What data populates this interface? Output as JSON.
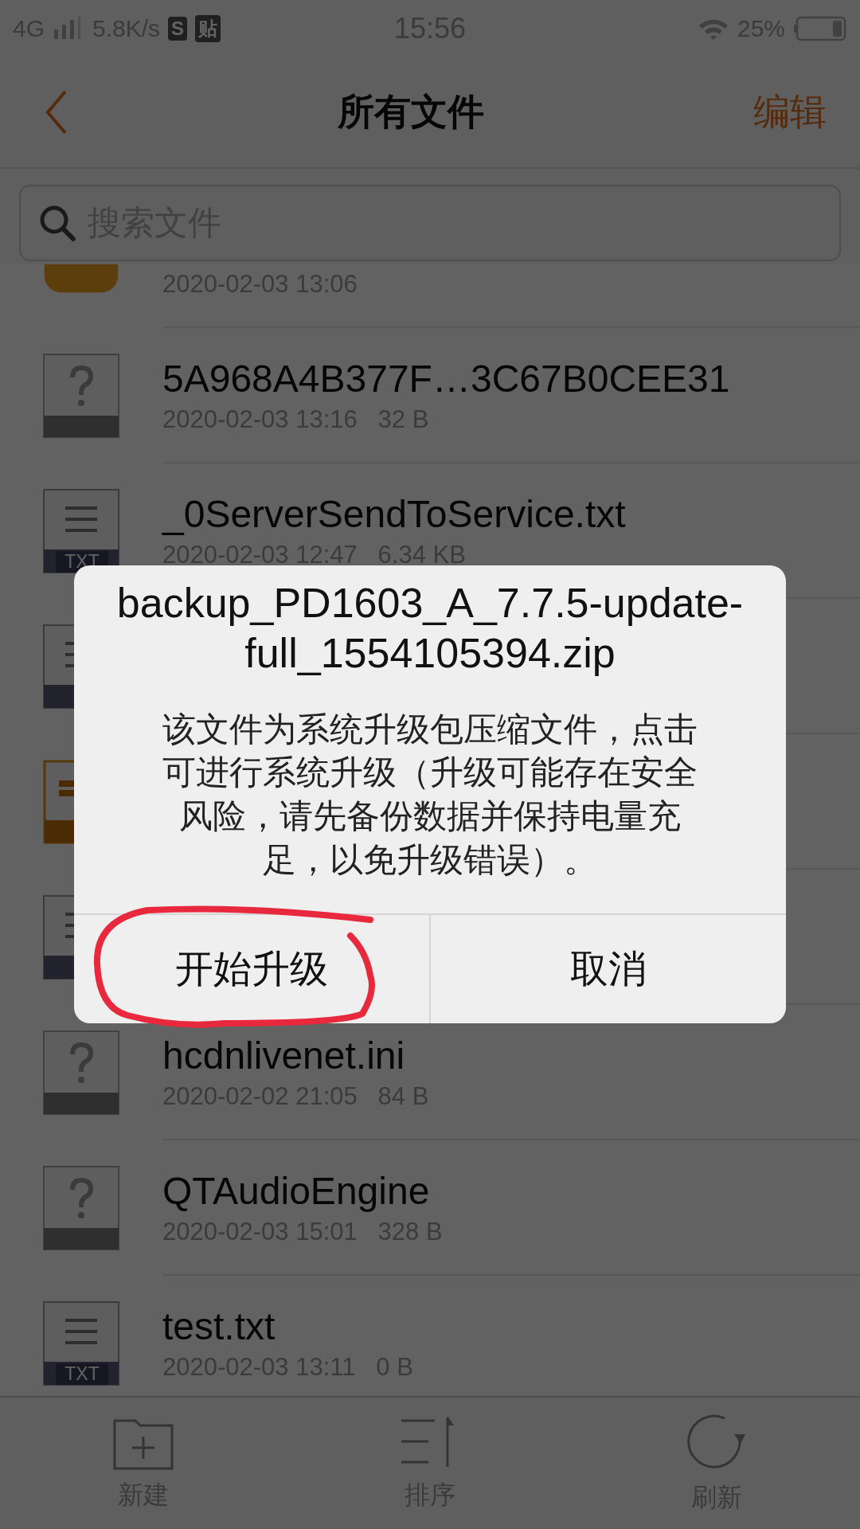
{
  "status_bar": {
    "network": "4G",
    "speed": "5.8K/s",
    "badges": [
      "S",
      "贴"
    ],
    "time": "15:56",
    "battery": "25%"
  },
  "header": {
    "title": "所有文件",
    "action": "编辑"
  },
  "search": {
    "placeholder": "搜索文件"
  },
  "files": [
    {
      "kind": "folder",
      "meta": "2020-02-03 13:06"
    },
    {
      "kind": "unknown",
      "name": "5A968A4B377F…3C67B0CEE31",
      "meta": "2020-02-03 13:16   32 B"
    },
    {
      "kind": "txt",
      "icon_label": "TXT",
      "name": "_0ServerSendToService.txt",
      "meta": "2020-02-03 12:47   6.34 KB"
    },
    {
      "kind": "txt"
    },
    {
      "kind": "zip"
    },
    {
      "kind": "txt"
    },
    {
      "kind": "unknown",
      "name": "hcdnlivenet.ini",
      "meta": "2020-02-02 21:05   84 B"
    },
    {
      "kind": "unknown",
      "name": "QTAudioEngine",
      "meta": "2020-02-03 15:01   328 B"
    },
    {
      "kind": "txt",
      "icon_label": "TXT",
      "name": "test.txt",
      "meta": "2020-02-03 13:11   0 B"
    }
  ],
  "toolbar": [
    {
      "kind": "new",
      "label": "新建"
    },
    {
      "kind": "sort",
      "label": "排序"
    },
    {
      "kind": "refresh",
      "label": "刷新"
    }
  ],
  "dialog": {
    "title": "backup_PD1603_A_7.7.5-update-full_1554105394.zip",
    "message": "该文件为系统升级包压缩文件，点击可进行系统升级（升级可能存在安全风险，请先备份数据并保持电量充足，以免升级错误）。",
    "buttons": [
      {
        "label": "开始升级"
      },
      {
        "label": "取消"
      }
    ]
  }
}
